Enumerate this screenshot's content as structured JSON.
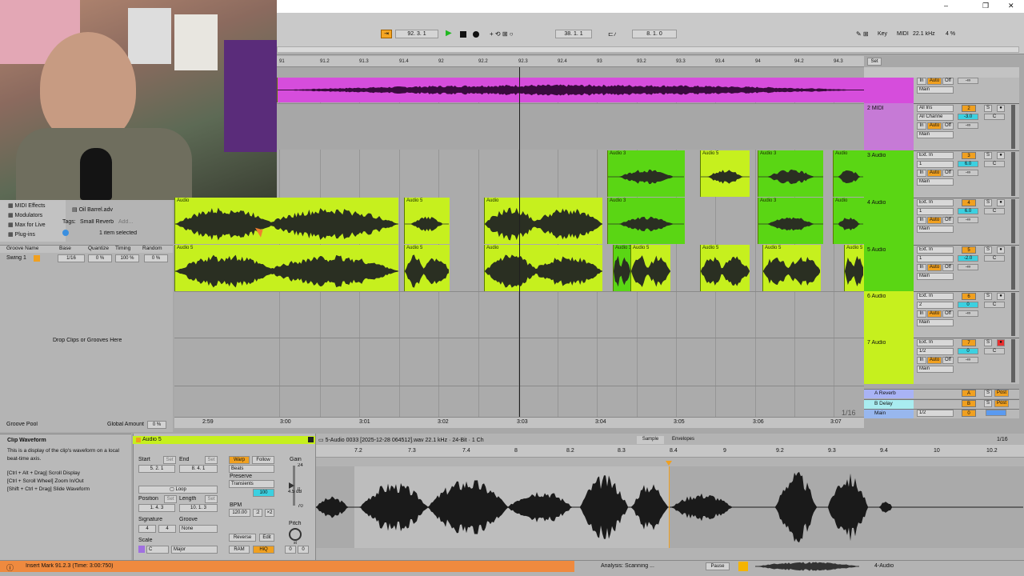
{
  "window": {
    "minimize": "–",
    "maximize": "❐",
    "close": "✕"
  },
  "transport": {
    "position": "92. 3. 1",
    "loop_start": "38. 1. 1",
    "loop_length": "8. 1. 0",
    "key_label": "Key",
    "midi_label": "MIDI",
    "sample_rate": "22.1 kHz",
    "cpu": "4 %"
  },
  "ruler": {
    "bars": [
      "91",
      "91.2",
      "91.3",
      "91.4",
      "92",
      "92.2",
      "92.3",
      "92.4",
      "93",
      "93.2",
      "93.3",
      "93.4",
      "94",
      "94.2",
      "94.3"
    ],
    "times": [
      "2:59",
      "3:00",
      "3:01",
      "3:02",
      "3:03",
      "3:04",
      "3:05",
      "3:06",
      "3:07"
    ],
    "set_label": "Set",
    "zoom": "1/16"
  },
  "browser": {
    "items": [
      "MIDI Effects",
      "Modulators",
      "Max for Live",
      "Plug-ins"
    ],
    "file": "Oil Barrel.adv",
    "tags_label": "Tags:",
    "tag": "Small Reverb",
    "add_label": "Add...",
    "selected": "1 item selected",
    "groove_headers": [
      "Groove Name",
      "Base",
      "Quantize",
      "Timing",
      "Random"
    ],
    "groove_row": {
      "name": "Swing 1",
      "base": "1/16",
      "quantize": "0 %",
      "timing": "100 %",
      "random": "0 %"
    },
    "drop_hint": "Drop Clips or Grooves Here",
    "groove_pool": "Groove Pool",
    "global_amount_label": "Global Amount",
    "global_amount": "0 %"
  },
  "tracks": [
    {
      "name": "2 MIDI",
      "num": "2",
      "input": "All Ins",
      "channel": "All Channe",
      "monitor": [
        "In",
        "Auto",
        "Off"
      ],
      "out": "Main",
      "vol": "-3.0",
      "pan": "C"
    },
    {
      "name": "3 Audio",
      "num": "3",
      "input": "Ext. In",
      "channel": "1",
      "monitor": [
        "In",
        "Auto",
        "Off"
      ],
      "out": "Main",
      "vol": "6.0",
      "pan": "C"
    },
    {
      "name": "4 Audio",
      "num": "4",
      "input": "Ext. In",
      "channel": "1",
      "monitor": [
        "In",
        "Auto",
        "Off"
      ],
      "out": "Main",
      "vol": "6.0",
      "pan": "C"
    },
    {
      "name": "5 Audio",
      "num": "5",
      "input": "Ext. In",
      "channel": "1",
      "monitor": [
        "In",
        "Auto",
        "Off"
      ],
      "out": "Main",
      "vol": "-2.0",
      "pan": "C"
    },
    {
      "name": "6 Audio",
      "num": "6",
      "input": "Ext. In",
      "channel": "2",
      "monitor": [
        "In",
        "Auto",
        "Off"
      ],
      "out": "Main",
      "vol": "0",
      "pan": "C"
    },
    {
      "name": "7 Audio",
      "num": "7",
      "input": "Ext. In",
      "channel": "1/2",
      "monitor": [
        "In",
        "Auto",
        "Off"
      ],
      "out": "Main",
      "vol": "0",
      "pan": "C"
    }
  ],
  "returns": [
    {
      "name": "A Reverb",
      "num": "A",
      "post": "Post"
    },
    {
      "name": "B Delay",
      "num": "B",
      "post": "Post"
    },
    {
      "name": "Main",
      "out": "1/2",
      "vol": "0"
    }
  ],
  "top_track": {
    "monitor": [
      "In",
      "Auto",
      "Off"
    ],
    "out": "Main",
    "neg_inf": "-∞"
  },
  "clip_labels": {
    "audio3": "Audio 3",
    "audio5": "Audio 5",
    "audio": "Audio"
  },
  "info": {
    "title": "Clip Waveform",
    "desc": "This is a display of the clip's waveform on a local beat-time axis.",
    "hints": [
      "[Ctrl + Alt + Drag] Scroll Display",
      "[Ctrl + Scroll Wheel] Zoom In/Out",
      "[Shift + Ctrl + Drag] Slide Waveform"
    ]
  },
  "clip_view": {
    "name": "Audio 5",
    "start_label": "Start",
    "end_label": "End",
    "set_label": "Set",
    "start": "5. 2. 1",
    "end": "8. 4. 1",
    "loop_label": "Loop",
    "position_label": "Position",
    "length_label": "Length",
    "position": "1. 4. 3",
    "length": "10. 1. 3",
    "signature_label": "Signature",
    "groove_label": "Groove",
    "sig_num": "4",
    "sig_den": "4",
    "groove": "None",
    "scale_label": "Scale",
    "scale_root": "C",
    "scale_mode": "Major",
    "warp": "Warp",
    "follow": "Follow",
    "warp_mode": "Beats",
    "preserve_label": "Preserve",
    "preserve": "Transients",
    "grain": "100",
    "bpm_label": "BPM",
    "bpm": "120.00",
    "half": ":2",
    "double": "×2",
    "reverse": "Reverse",
    "edit": "Edit",
    "ram": "RAM",
    "hiq": "HiQ",
    "gain_label": "Gain",
    "gain_top": "24",
    "gain_zero": "0",
    "gain_val": "4.5 dB",
    "gain_bottom": "70",
    "pitch_label": "Pitch",
    "pitch_st": "st",
    "pitch_val": "0",
    "pitch_cents": "0"
  },
  "sample": {
    "file": "5-Audio 0033 [2025-12-28 064512].wav  22.1 kHz · 24-Bit · 1 Ch",
    "tab_sample": "Sample",
    "tab_envelopes": "Envelopes",
    "zoom": "1/16",
    "ruler": [
      "7.2",
      "7.3",
      "7.4",
      "8",
      "8.2",
      "8.3",
      "8.4",
      "9",
      "9.2",
      "9.3",
      "9.4",
      "10",
      "10.2"
    ]
  },
  "status": {
    "message": "Insert Mark 91.2.3 (Time: 3:00:750)",
    "analysis": "Analysis: Scanning ...",
    "pause": "Pause",
    "track": "4-Audio"
  },
  "colors": {
    "magenta": "#d64ddc",
    "lime": "#c6f01e",
    "green": "#5ad614",
    "orange": "#ef8a3f"
  }
}
